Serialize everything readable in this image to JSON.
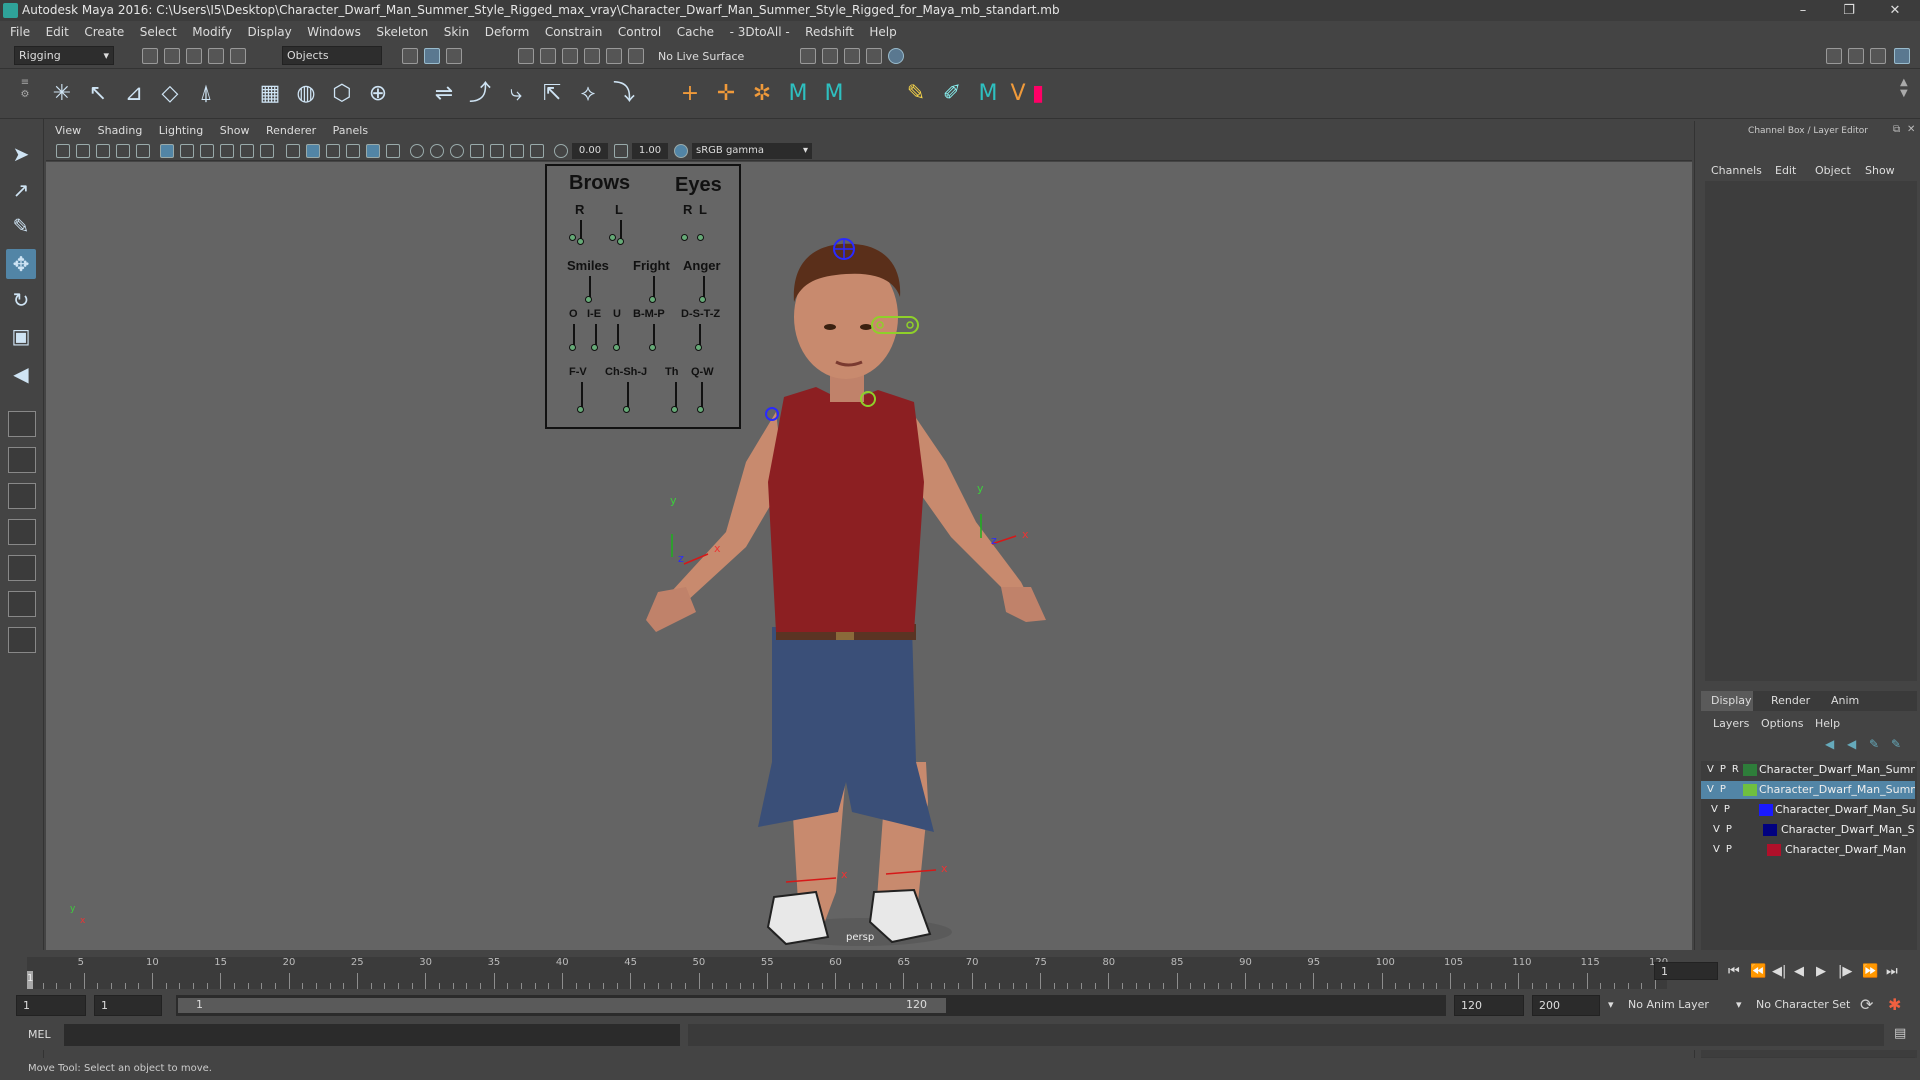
{
  "window": {
    "title": "Autodesk Maya 2016: C:\\Users\\I5\\Desktop\\Character_Dwarf_Man_Summer_Style_Rigged_max_vray\\Character_Dwarf_Man_Summer_Style_Rigged_for_Maya_mb_standart.mb",
    "minimize": "–",
    "restore": "❐",
    "close": "✕"
  },
  "menu": [
    "File",
    "Edit",
    "Create",
    "Select",
    "Modify",
    "Display",
    "Windows",
    "Skeleton",
    "Skin",
    "Deform",
    "Constrain",
    "Control",
    "Cache",
    "- 3DtoAll -",
    "Redshift",
    "Help"
  ],
  "statusline": {
    "menuset": "Rigging",
    "select_mode": "Objects",
    "live_surface": "No Live Surface"
  },
  "viewport": {
    "menu": [
      "View",
      "Shading",
      "Lighting",
      "Show",
      "Renderer",
      "Panels"
    ],
    "exposure": "0.00",
    "gamma": "1.00",
    "color_space": "sRGB gamma",
    "camera_label": "persp",
    "axis_y": "y",
    "axis_x": "x",
    "axis_z": "z"
  },
  "face_panel": {
    "brows": "Brows",
    "eyes": "Eyes",
    "r": "R",
    "l": "L",
    "smiles": "Smiles",
    "fright": "Fright",
    "anger": "Anger",
    "o": "O",
    "ie": "I-E",
    "u": "U",
    "bmp": "B-M-P",
    "dstz": "D-S-T-Z",
    "fv": "F-V",
    "chshj": "Ch-Sh-J",
    "th": "Th",
    "qw": "Q-W"
  },
  "channel_box": {
    "title": "Channel Box / Layer Editor",
    "tabs": [
      "Channels",
      "Edit",
      "Object",
      "Show"
    ]
  },
  "layer_editor": {
    "tabs": [
      "Display",
      "Render",
      "Anim"
    ],
    "menu": [
      "Layers",
      "Options",
      "Help"
    ],
    "layers": [
      {
        "flags": "VPR",
        "name": "Character_Dwarf_Man_Summ",
        "color": "#2e7d3a"
      },
      {
        "flags": "VP",
        "name": "Character_Dwarf_Man_Summ",
        "color": "#6fbf3f"
      },
      {
        "flags": "VP",
        "name": "Character_Dwarf_Man_Su",
        "color": "#1a1aff"
      },
      {
        "flags": "VP",
        "name": "Character_Dwarf_Man_S",
        "color": "#000080"
      },
      {
        "flags": "VP",
        "name": "Character_Dwarf_Man",
        "color": "#b0102a"
      }
    ]
  },
  "timeline": {
    "ticks": [
      "5",
      "10",
      "15",
      "20",
      "25",
      "30",
      "35",
      "40",
      "45",
      "50",
      "55",
      "60",
      "65",
      "70",
      "75",
      "80",
      "85",
      "90",
      "95",
      "100",
      "105",
      "110",
      "115",
      "120"
    ],
    "start_marker": "1",
    "current_frame": "1"
  },
  "range": {
    "start": "1",
    "anim_start": "1",
    "slider_start": "1",
    "slider_end": "120",
    "end": "120",
    "anim_end": "200",
    "anim_layer": "No Anim Layer",
    "character_set": "No Character Set"
  },
  "cmdline": {
    "lang": "MEL"
  },
  "helpline": {
    "text": "Move Tool: Select an object to move."
  }
}
